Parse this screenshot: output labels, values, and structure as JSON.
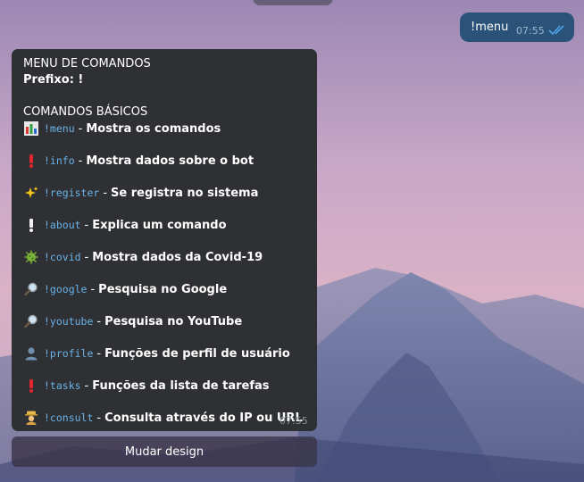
{
  "outgoing": {
    "text": "!menu",
    "time": "07:55"
  },
  "bubble": {
    "title": "MENU DE COMANDOS",
    "prefix": "Prefixo: !",
    "section": "COMANDOS BÁSICOS",
    "time": "07:55",
    "commands": [
      {
        "icon": "bar-chart-icon",
        "code": "!menu",
        "desc": "Mostra os comandos"
      },
      {
        "icon": "exclamation-icon",
        "code": "!info",
        "desc": "Mostra dados sobre o bot"
      },
      {
        "icon": "sparkles-icon",
        "code": "!register",
        "desc": "Se registra no sistema"
      },
      {
        "icon": "white-exclamation-icon",
        "code": "!about",
        "desc": "Explica um comando"
      },
      {
        "icon": "virus-icon",
        "code": "!covid",
        "desc": "Mostra dados da Covid-19"
      },
      {
        "icon": "magnifier-icon",
        "code": "!google",
        "desc": "Pesquisa no Google"
      },
      {
        "icon": "magnifier-icon",
        "code": "!youtube",
        "desc": "Pesquisa no YouTube"
      },
      {
        "icon": "user-icon",
        "code": "!profile",
        "desc": "Funções de perfil de usuário"
      },
      {
        "icon": "exclamation-icon",
        "code": "!tasks",
        "desc": "Funções da lista de tarefas"
      },
      {
        "icon": "detective-icon",
        "code": "!consult",
        "desc": "Consulta através do IP ou URL"
      }
    ],
    "separator": "-"
  },
  "keyboard": {
    "button_label": "Mudar design"
  },
  "colors": {
    "bubble_bg": "#2e3033",
    "outgoing_bg": "#2b5278",
    "code_color": "#6ab2e8",
    "check_color": "#4fa3e8"
  }
}
